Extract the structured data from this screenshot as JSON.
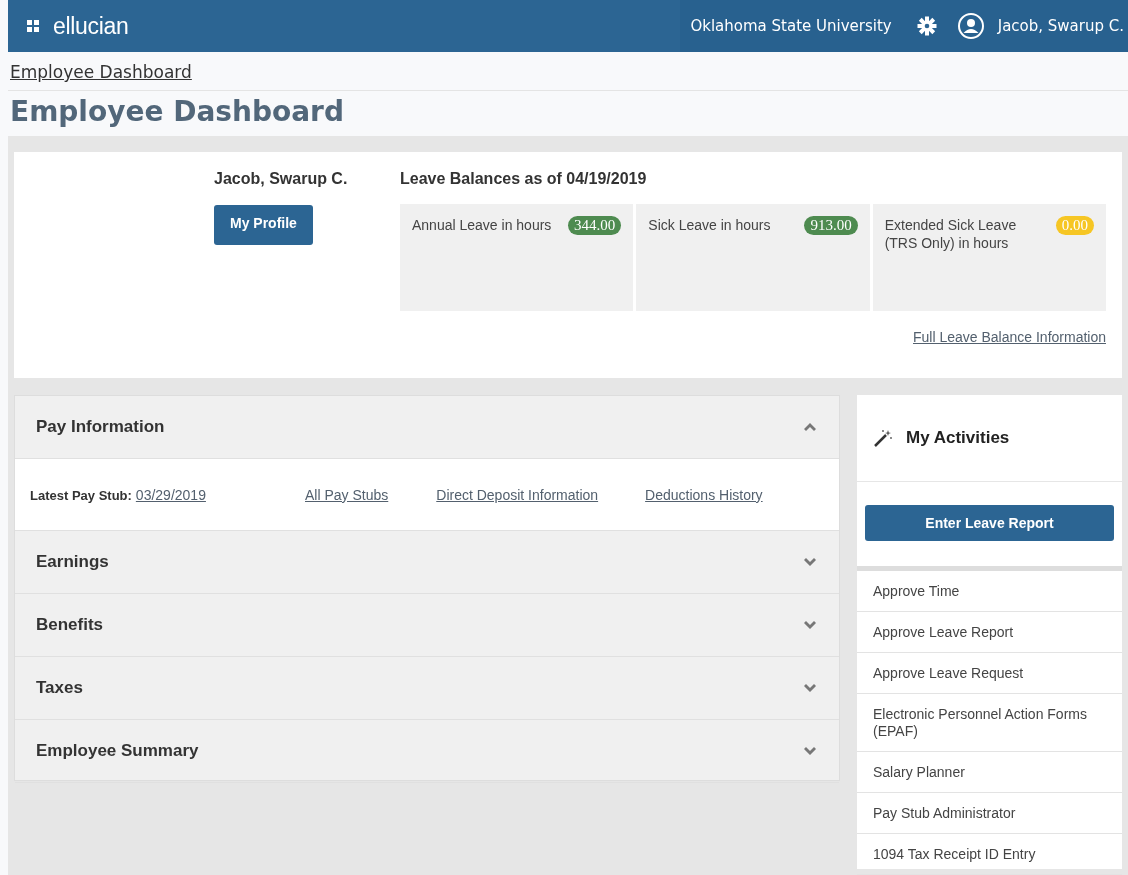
{
  "header": {
    "brand": "ellucian",
    "institution": "Oklahoma State University",
    "user": "Jacob, Swarup C."
  },
  "breadcrumb": "Employee Dashboard",
  "page_title": "Employee Dashboard",
  "profile": {
    "name": "Jacob, Swarup C.",
    "button": "My Profile"
  },
  "leave_balances": {
    "title": "Leave Balances as of 04/19/2019",
    "items": [
      {
        "label": "Annual Leave in hours",
        "value": "344.00",
        "color": "#4e8b50"
      },
      {
        "label": "Sick Leave in hours",
        "value": "913.00",
        "color": "#4e8b50"
      },
      {
        "label": "Extended Sick Leave (TRS Only) in hours",
        "value": "0.00",
        "color": "#f6c624"
      }
    ],
    "link": "Full Leave Balance Information"
  },
  "sections": [
    {
      "title": "Pay Information",
      "expanded": true,
      "content": {
        "stub_label": "Latest Pay Stub:",
        "stub_link": "03/29/2019",
        "links": [
          "All Pay Stubs",
          "Direct Deposit Information",
          "Deductions History"
        ]
      }
    },
    {
      "title": "Earnings",
      "expanded": false
    },
    {
      "title": "Benefits",
      "expanded": false
    },
    {
      "title": "Taxes",
      "expanded": false
    },
    {
      "title": "Employee Summary",
      "expanded": false
    }
  ],
  "activities": {
    "title": "My Activities",
    "button": "Enter Leave Report",
    "items": [
      "Approve Time",
      "Approve Leave Report",
      "Approve Leave Request",
      "Electronic Personnel Action Forms (EPAF)",
      "Salary Planner",
      "Pay Stub Administrator",
      "1094 Tax Receipt ID Entry"
    ]
  }
}
